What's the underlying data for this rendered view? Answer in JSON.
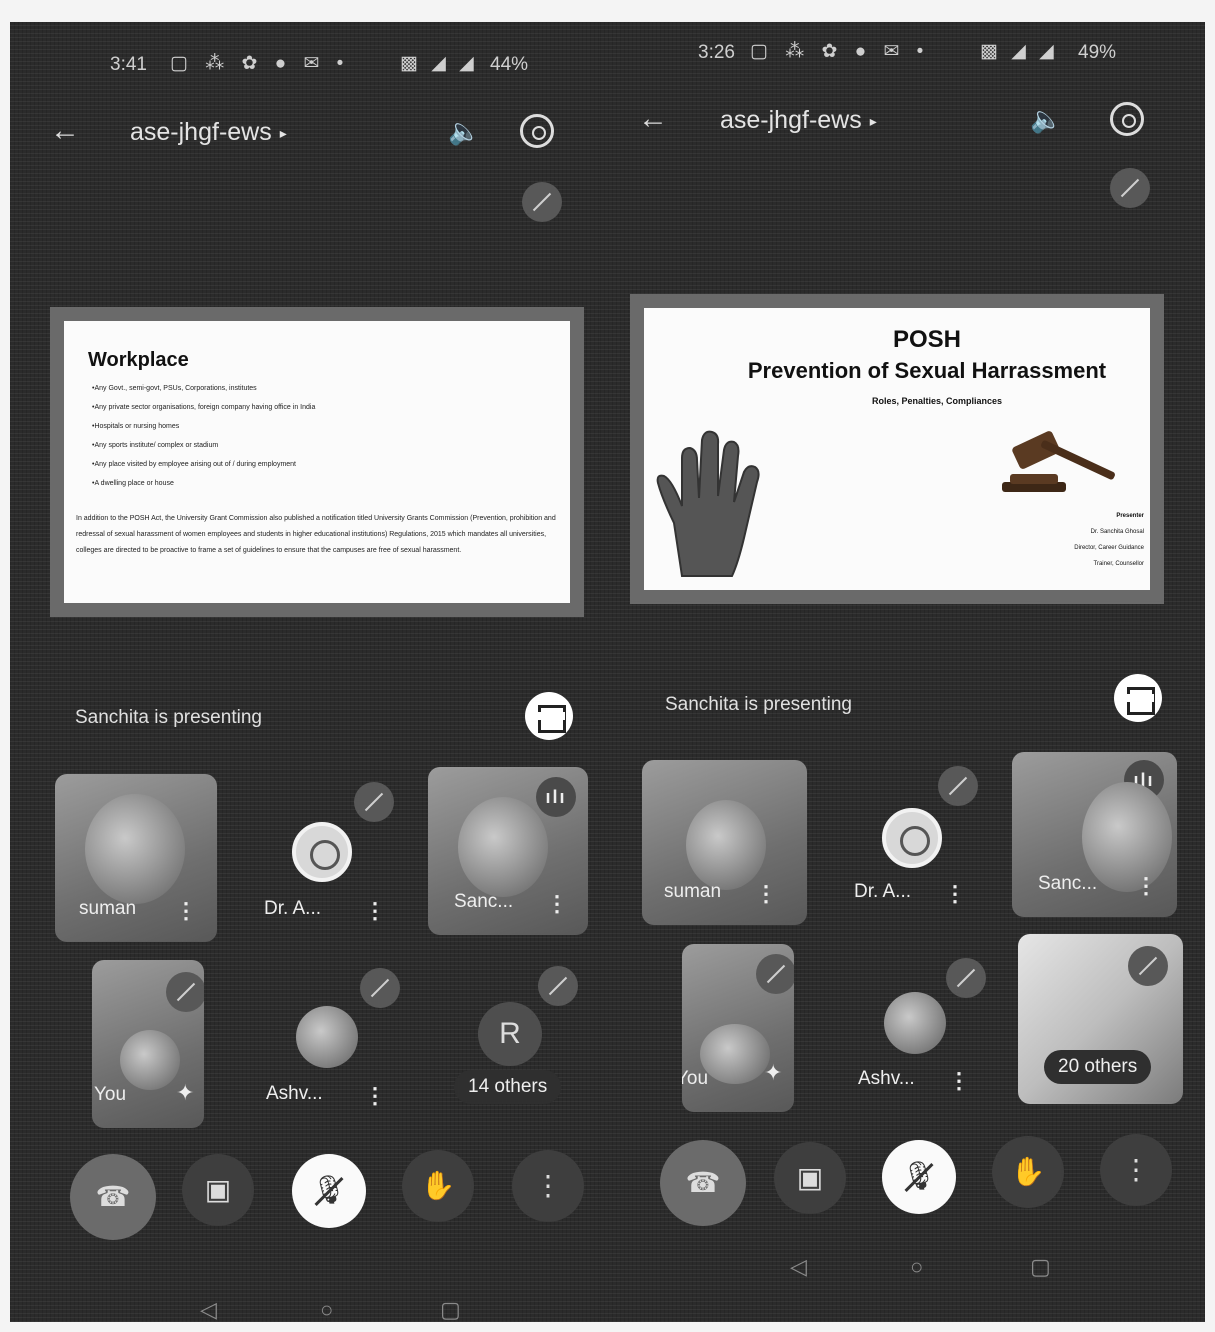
{
  "left_screen": {
    "status_bar": {
      "time": "3:41",
      "icons": "▢ ⁂ ✿ ● ✉ •",
      "signal": "▩ ◢ ◢",
      "battery": "44%"
    },
    "top_bar": {
      "back_icon": "←",
      "meeting_code": "ase-jhgf-ews",
      "chevron": "▸",
      "speaker_icon": "🔈"
    },
    "slide": {
      "title": "Workplace",
      "bullets": [
        "•Any Govt., semi-govt, PSUs, Corporations, institutes",
        "•Any private sector organisations, foreign company having office in India",
        "•Hospitals or nursing homes",
        "•Any sports institute/ complex or stadium",
        "•Any place visited by employee arising out of / during employment",
        "•A dwelling place or house"
      ],
      "paragraph": "In addition to the POSH Act, the University Grant Commission also published a notification titled University Grants Commission (Prevention, prohibition and redressal of sexual harassment of women employees and students in higher educational institutions) Regulations, 2015 which mandates all universities, colleges are directed to be proactive to frame a set of guidelines to ensure that the campuses are free of sexual harassment."
    },
    "presenting_label": "Sanchita is presenting",
    "tiles": {
      "suman": "suman",
      "dr_a": "Dr. A...",
      "sanc": "Sanc...",
      "you": "You",
      "ashv": "Ashv...",
      "avatar_letter": "R",
      "others": "14 others"
    },
    "controls": {
      "end_call_icon": "☎",
      "camera_icon": "▣",
      "mic_icon": "🎙",
      "hand_icon": "✋",
      "more_icon": "⋮"
    }
  },
  "right_screen": {
    "status_bar": {
      "time": "3:26",
      "icons": "▢ ⁂ ✿ ● ✉ •",
      "signal": "▩ ◢ ◢",
      "battery": "49%"
    },
    "top_bar": {
      "back_icon": "←",
      "meeting_code": "ase-jhgf-ews",
      "chevron": "▸",
      "speaker_icon": "🔈"
    },
    "slide": {
      "title": "POSH",
      "subtitle": "Prevention of Sexual Harrassment",
      "tagline": "Roles, Penalties, Compliances",
      "presenter_heading": "Presenter",
      "presenter_lines": [
        "Dr. Sanchita Ghosal",
        "Director, Career Guidance",
        "Trainer, Counsellor"
      ]
    },
    "presenting_label": "Sanchita is presenting",
    "tiles": {
      "suman": "suman",
      "dr_a": "Dr. A...",
      "sanc": "Sanc...",
      "you": "You",
      "ashv": "Ashv...",
      "others": "20 others"
    },
    "controls": {
      "end_call_icon": "☎",
      "camera_icon": "▣",
      "mic_icon": "🎙",
      "hand_icon": "✋",
      "more_icon": "⋮"
    }
  },
  "nav_bar": {
    "back": "◁",
    "home": "○",
    "recents": "▢"
  },
  "icons": {
    "mute": "mic-off-icon",
    "talking": "audio-level-icon",
    "sparkle": "effects-sparkle-icon",
    "fullscreen": "fullscreen-icon",
    "switch_camera": "switch-camera-icon"
  },
  "colors": {
    "background": "#2b2b2b",
    "tile": "#3c3c3c",
    "pill": "#2f2f2f",
    "mic_button": "#fafafa"
  }
}
